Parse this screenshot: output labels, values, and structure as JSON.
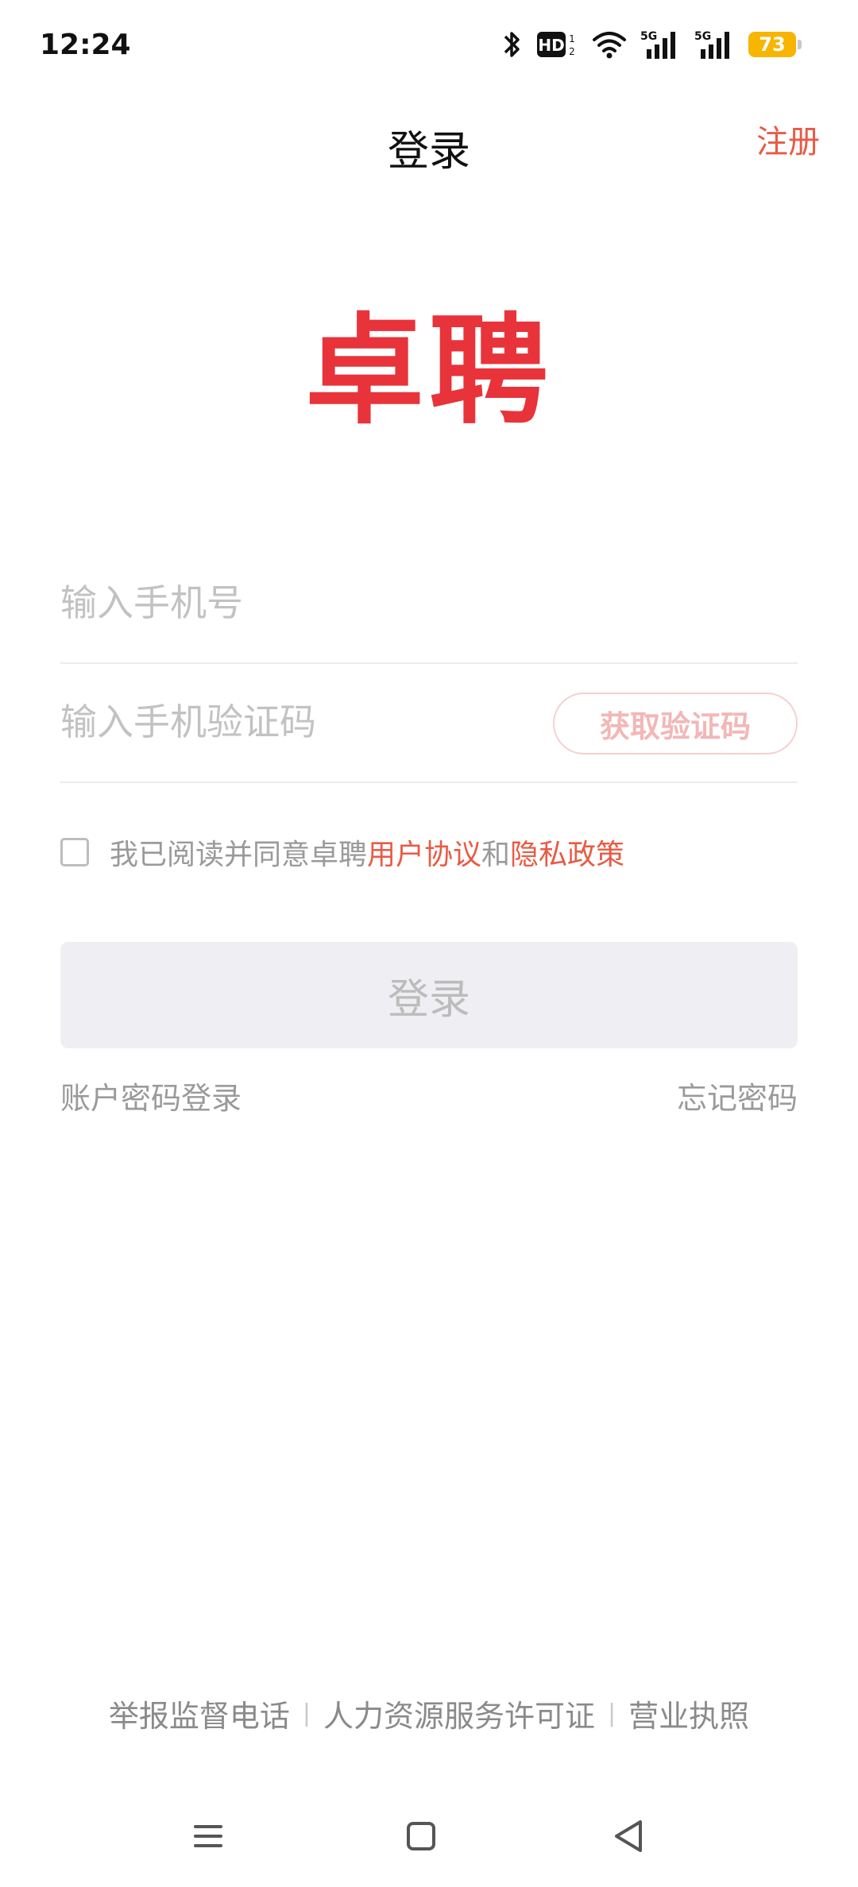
{
  "status_bar": {
    "time": "12:24",
    "battery_level": "73",
    "icons": [
      "bluetooth-icon",
      "hd-icon",
      "wifi-icon",
      "5g-signal-icon",
      "5g-signal-icon",
      "battery-icon"
    ]
  },
  "header": {
    "title": "登录",
    "register_label": "注册"
  },
  "logo": {
    "text": "卓聘"
  },
  "form": {
    "phone_placeholder": "输入手机号",
    "code_placeholder": "输入手机验证码",
    "get_code_label": "获取验证码",
    "agreement_prefix": "我已阅读并同意卓聘",
    "user_agreement": "用户协议",
    "agreement_and": "和",
    "privacy_policy": "隐私政策",
    "agreement_checked": false,
    "login_label": "登录",
    "password_login_label": "账户密码登录",
    "forgot_password_label": "忘记密码"
  },
  "footer": {
    "report_phone": "举报监督电话",
    "hr_license": "人力资源服务许可证",
    "business_license": "营业执照",
    "separator": "|"
  },
  "nav_bar": {
    "buttons": [
      "menu-icon",
      "home-icon",
      "back-icon"
    ]
  },
  "colors": {
    "accent": "#e85b44",
    "logo": "#e8333a",
    "battery": "#f7b500"
  }
}
